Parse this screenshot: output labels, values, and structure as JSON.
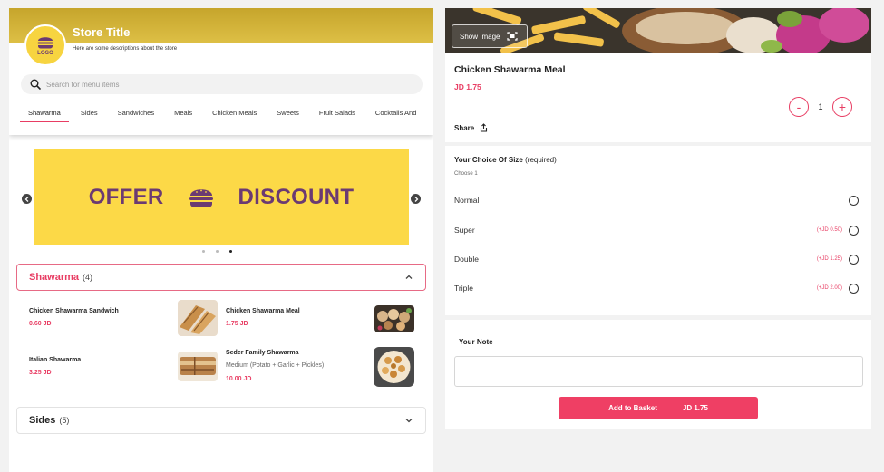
{
  "store": {
    "title": "Store Title",
    "description": "Here are some descriptions about the store",
    "logo_text": "LOGO"
  },
  "search": {
    "placeholder": "Search for menu items"
  },
  "categories": [
    "Shawarma",
    "Sides",
    "Sandwiches",
    "Meals",
    "Chicken Meals",
    "Sweets",
    "Fruit Salads",
    "Cocktails And"
  ],
  "banner": {
    "left_text": "OFFER",
    "right_text": "DISCOUNT",
    "slides": 3,
    "active_slide": 3
  },
  "sections": [
    {
      "title": "Shawarma",
      "count": "(4)",
      "items": [
        {
          "name": "Chicken Shawarma Sandwich",
          "description": "",
          "price": "0.60 JD"
        },
        {
          "name": "Chicken Shawarma Meal",
          "description": "",
          "price": "1.75 JD"
        },
        {
          "name": "Italian Shawarma",
          "description": "",
          "price": "3.25 JD"
        },
        {
          "name": "Seder Family Shawarma",
          "description": "Medium (Potato + Garlic + Pickles)",
          "price": "10.00 JD"
        }
      ]
    },
    {
      "title": "Sides",
      "count": "(5)"
    }
  ],
  "product": {
    "show_image_label": "Show Image",
    "name": "Chicken Shawarma Meal",
    "price": "JD 1.75",
    "quantity": "1",
    "minus": "-",
    "plus": "+",
    "share_label": "Share"
  },
  "options": {
    "title": "Your Choice Of Size",
    "required": "(required)",
    "subtitle": "Choose 1",
    "choices": [
      {
        "label": "Normal",
        "extra": ""
      },
      {
        "label": "Super",
        "extra": "(+JD 0.50)"
      },
      {
        "label": "Double",
        "extra": "(+JD 1.25)"
      },
      {
        "label": "Triple",
        "extra": "(+JD 2.00)"
      }
    ]
  },
  "note": {
    "label": "Your Note",
    "value": ""
  },
  "add_to_basket": {
    "label": "Add to Basket",
    "price": "JD 1.75"
  },
  "colors": {
    "accent": "#ef3f64",
    "brand_yellow": "#fcd947",
    "brand_purple": "#6b3a72",
    "header_gold": "#cfae33"
  },
  "icons": [
    "burger-icon",
    "search-icon",
    "chevron-left-icon",
    "chevron-right-icon",
    "chevron-up-icon",
    "chevron-down-icon",
    "expand-icon",
    "share-icon"
  ]
}
